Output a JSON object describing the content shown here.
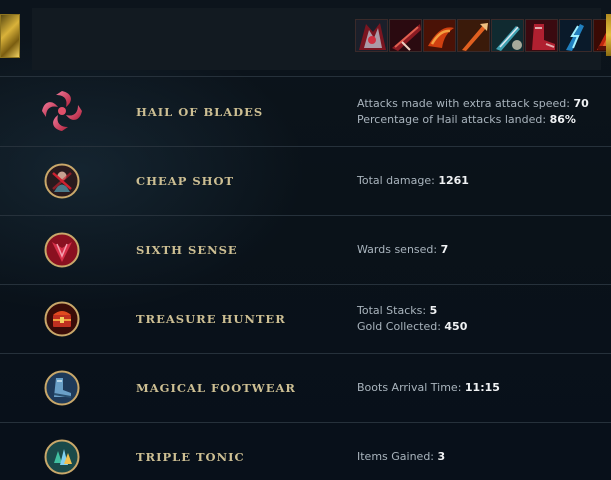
{
  "items": [
    {
      "icon": "item-armor-icon",
      "colors": [
        "#7a1520",
        "#1b1f2a",
        "#c8c8d0"
      ]
    },
    {
      "icon": "item-blade-icon",
      "colors": [
        "#8a1a22",
        "#2a0a10",
        "#d85040"
      ]
    },
    {
      "icon": "item-fire-claw-icon",
      "colors": [
        "#4a1206",
        "#d04010",
        "#f4a040"
      ]
    },
    {
      "icon": "item-spear-icon",
      "colors": [
        "#3a1a0a",
        "#e06020",
        "#f0c080"
      ]
    },
    {
      "icon": "item-dagger-icon",
      "colors": [
        "#102a30",
        "#40a0b0",
        "#e0e8f0"
      ]
    },
    {
      "icon": "item-boots-icon",
      "colors": [
        "#3a0a10",
        "#b02030",
        "#e0b0b0"
      ]
    },
    {
      "icon": "item-lightning-icon",
      "colors": [
        "#0a1a2a",
        "#2080c0",
        "#a0f0ff"
      ]
    },
    {
      "icon": "item-altar-icon",
      "colors": [
        "#3a0a04",
        "#c02810",
        "#f07030"
      ]
    }
  ],
  "runes": [
    {
      "name": "HAIL OF BLADES",
      "icon": "hail-of-blades-icon",
      "stats": [
        {
          "label": "Attacks made with extra attack speed: ",
          "value": "70"
        },
        {
          "label": "Percentage of Hail attacks landed: ",
          "value": "86%"
        }
      ]
    },
    {
      "name": "CHEAP SHOT",
      "icon": "cheap-shot-icon",
      "stats": [
        {
          "label": "Total damage: ",
          "value": "1261"
        }
      ]
    },
    {
      "name": "SIXTH SENSE",
      "icon": "sixth-sense-icon",
      "stats": [
        {
          "label": "Wards sensed: ",
          "value": "7"
        }
      ]
    },
    {
      "name": "TREASURE HUNTER",
      "icon": "treasure-hunter-icon",
      "stats": [
        {
          "label": "Total Stacks: ",
          "value": "5"
        },
        {
          "label": "Gold Collected: ",
          "value": "450"
        }
      ]
    },
    {
      "name": "MAGICAL FOOTWEAR",
      "icon": "magical-footwear-icon",
      "stats": [
        {
          "label": "Boots Arrival Time: ",
          "value": "11:15"
        }
      ]
    },
    {
      "name": "TRIPLE TONIC",
      "icon": "triple-tonic-icon",
      "stats": [
        {
          "label": "Items Gained: ",
          "value": "3"
        }
      ]
    }
  ]
}
